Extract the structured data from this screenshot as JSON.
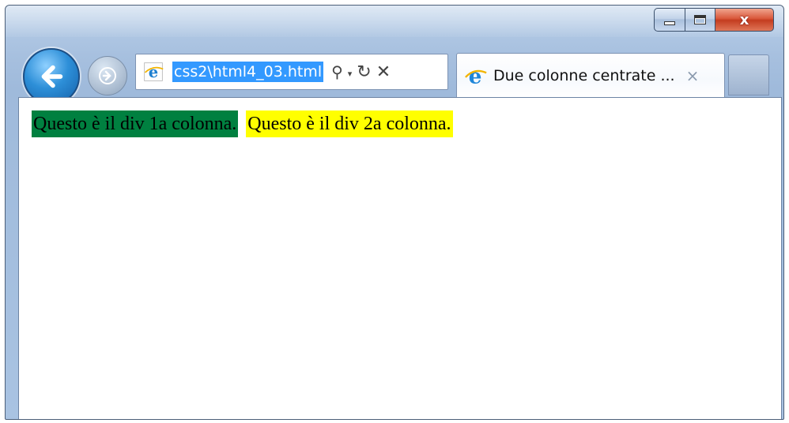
{
  "browser": {
    "address_bar": {
      "url": "css2\\html4_03.html"
    },
    "tab": {
      "title": "Due colonne centrate ...",
      "close_glyph": "×"
    },
    "caption": {
      "minimize_icon": "minimize-icon",
      "maximize_icon": "maximize-icon",
      "close_glyph": "x"
    },
    "toolbar": {
      "search_glyph": "⚲",
      "dropdown_glyph": "▾",
      "refresh_glyph": "↻",
      "stop_glyph": "✕"
    }
  },
  "page": {
    "column1": {
      "text": "Questo è il div 1a colonna.",
      "color": "#008040"
    },
    "column2": {
      "text": "Questo è il div 2a colonna.",
      "color": "#ffff00"
    }
  }
}
